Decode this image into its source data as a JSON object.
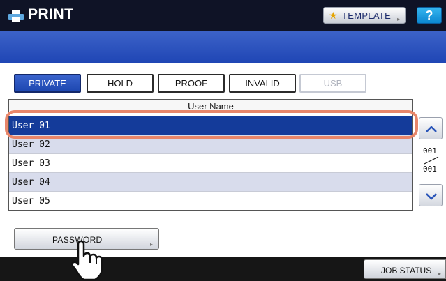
{
  "header": {
    "title": "PRINT",
    "icon": "printer-icon",
    "template_label": "TEMPLATE",
    "help_label": "?"
  },
  "tabs": [
    {
      "label": "PRIVATE",
      "state": "active"
    },
    {
      "label": "HOLD",
      "state": "normal"
    },
    {
      "label": "PROOF",
      "state": "normal"
    },
    {
      "label": "INVALID",
      "state": "normal"
    },
    {
      "label": "USB",
      "state": "disabled"
    }
  ],
  "list": {
    "column_header": "User Name",
    "rows": [
      "User 01",
      "User 02",
      "User 03",
      "User 04",
      "User 05"
    ],
    "selected_index": 0
  },
  "pager": {
    "current": "001",
    "total": "001"
  },
  "buttons": {
    "password": "PASSWORD",
    "job_status": "JOB STATUS"
  },
  "colors": {
    "title_bar": "#0f1326",
    "accent_blue": "#1f46b5",
    "selected_row": "#143b9a",
    "highlight": "#e8866a"
  }
}
